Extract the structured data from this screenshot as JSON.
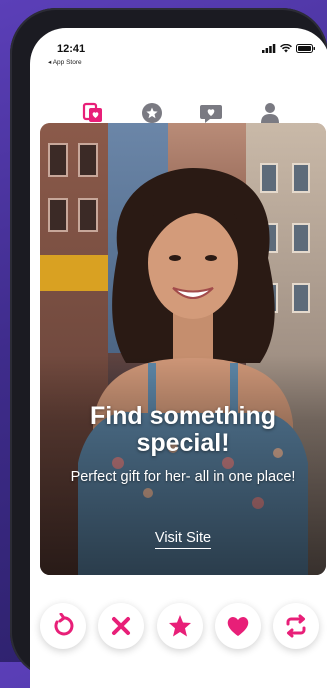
{
  "status_bar": {
    "time": "12:41",
    "back_label": "◂ App Store"
  },
  "nav": {
    "items": [
      {
        "icon": "cards-icon",
        "active": true
      },
      {
        "icon": "star-circle-icon",
        "active": false
      },
      {
        "icon": "chat-heart-icon",
        "active": false
      },
      {
        "icon": "profile-icon",
        "active": false
      }
    ]
  },
  "card": {
    "headline": "Find something special!",
    "subline": "Perfect gift for her- all in one place!",
    "link_label": "Visit Site"
  },
  "actions": [
    {
      "icon": "rewind-icon"
    },
    {
      "icon": "close-icon"
    },
    {
      "icon": "star-icon"
    },
    {
      "icon": "heart-icon"
    },
    {
      "icon": "boost-icon"
    }
  ],
  "colors": {
    "accent": "#e81f78",
    "nav_inactive": "#7a7a82",
    "background_top": "#5b3fb8",
    "background_bottom": "#2a1f66"
  }
}
